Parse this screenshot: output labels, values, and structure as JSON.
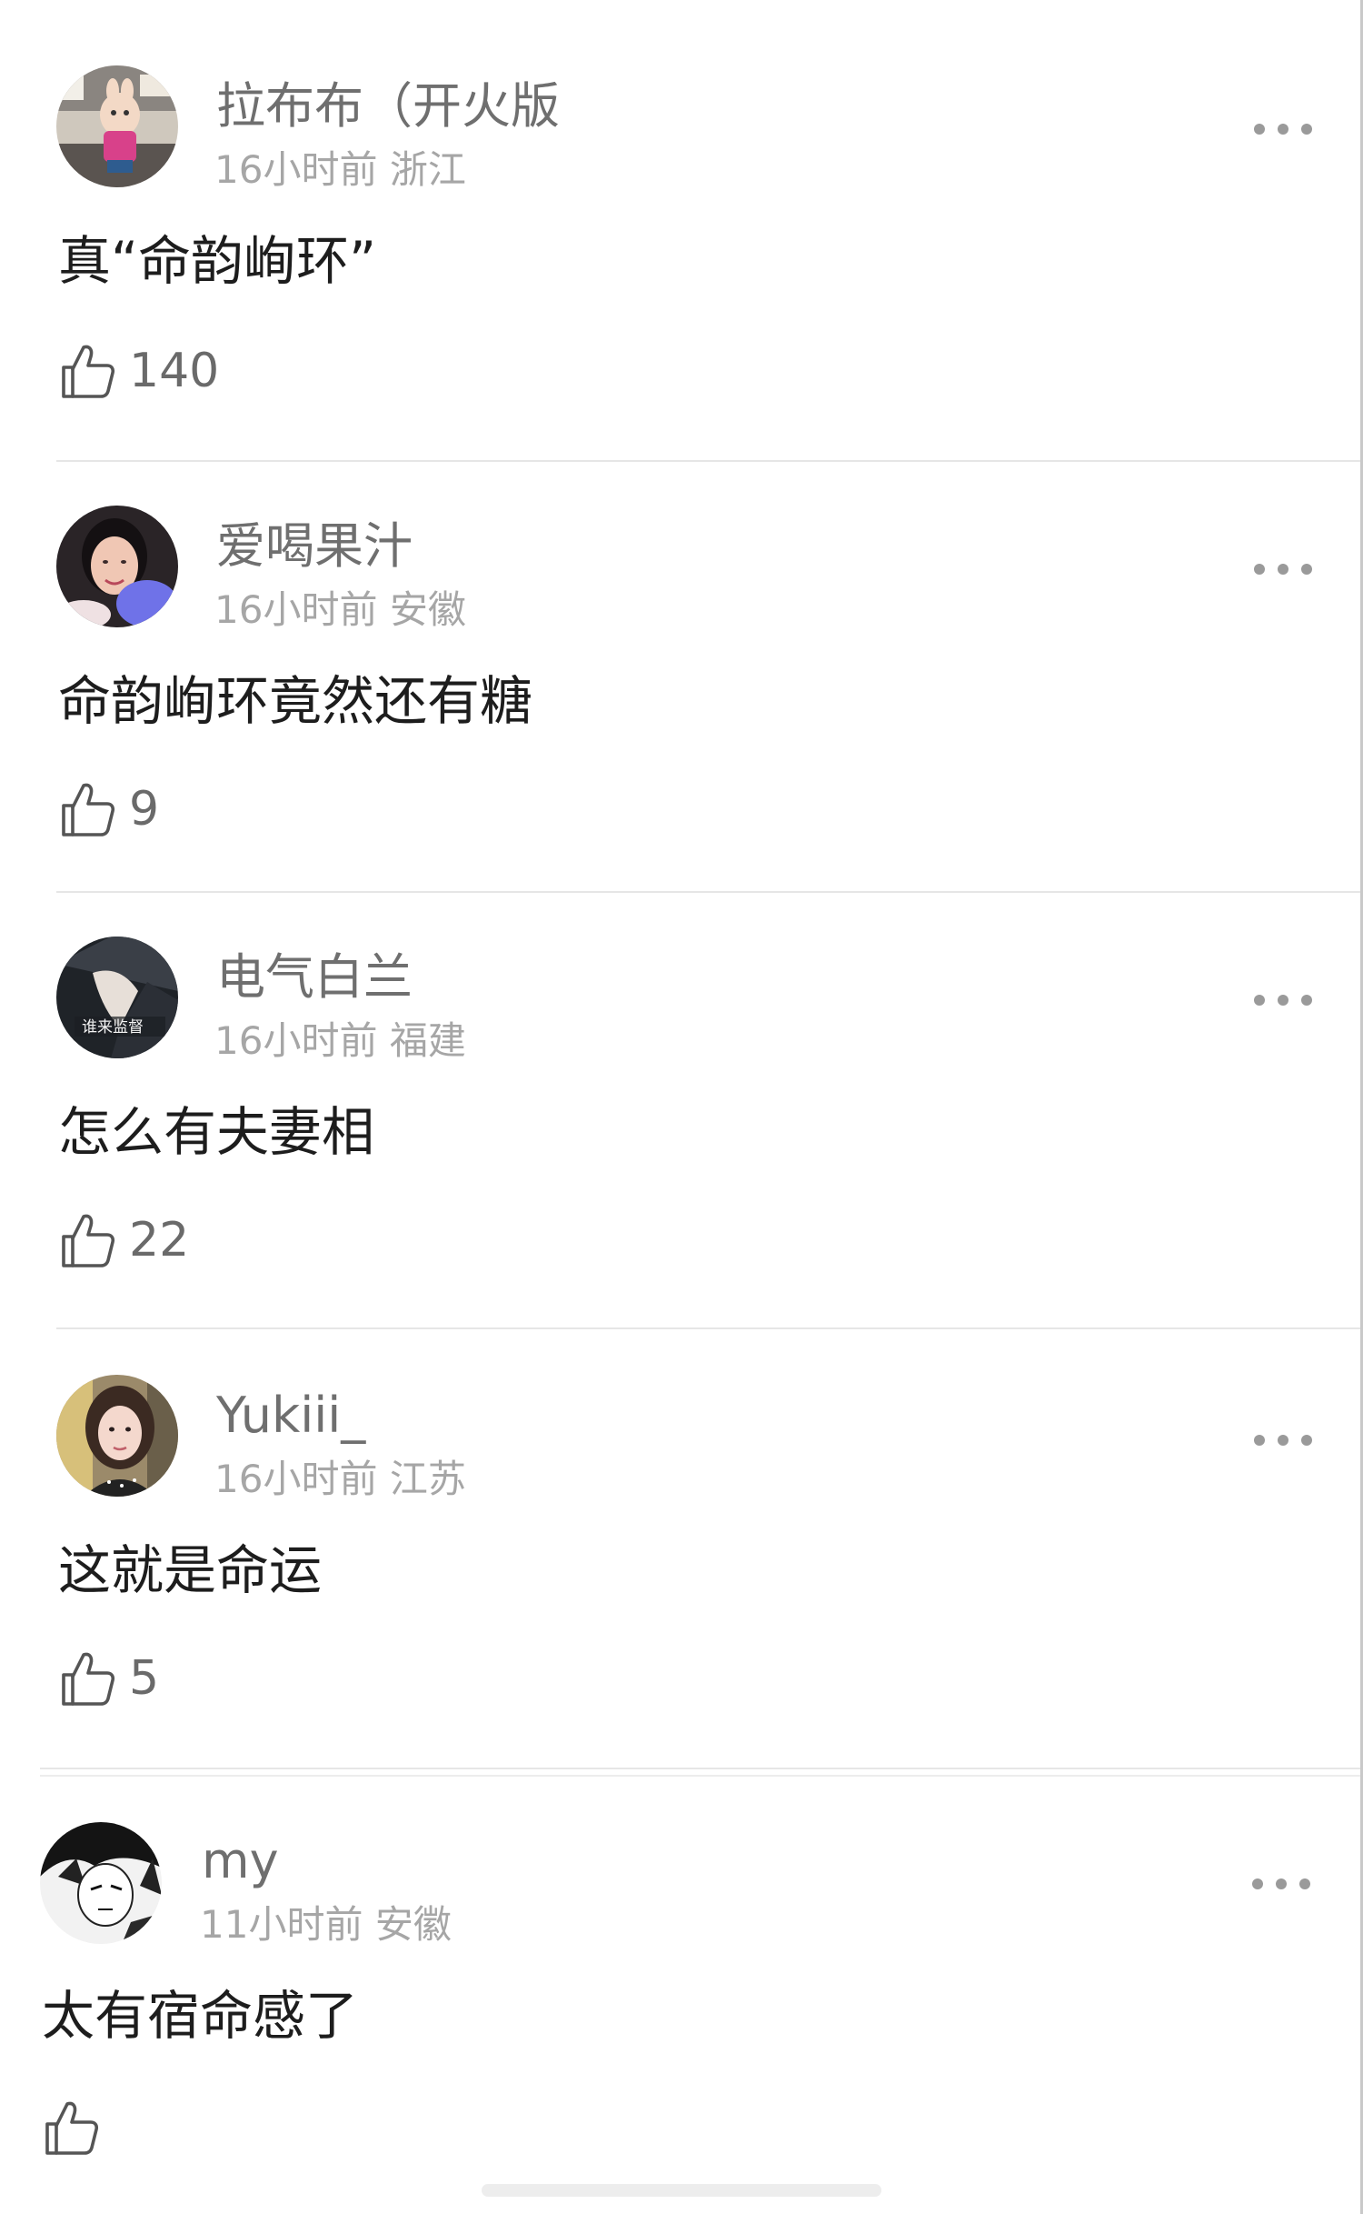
{
  "comments": [
    {
      "username": "拉布布（开火版",
      "time": "16小时前",
      "location": "浙江",
      "text": "真“命韵峋环”",
      "likes": "140"
    },
    {
      "username": "爱喝果汁",
      "time": "16小时前",
      "location": "安徽",
      "text": "命韵峋环竟然还有糖",
      "likes": "9"
    },
    {
      "username": "电气白兰",
      "time": "16小时前",
      "location": "福建",
      "text": "怎么有夫妻相",
      "likes": "22",
      "avatar_text": "谁来监督"
    },
    {
      "username": "Yukiii_",
      "time": "16小时前",
      "location": "江苏",
      "text": "这就是命运",
      "likes": "5"
    },
    {
      "username": "my",
      "time": "11小时前",
      "location": "安徽",
      "text": "太有宿命感了",
      "likes": ""
    }
  ],
  "icons": {
    "like": "thumbs-up-outline-icon",
    "more": "more-horizontal-icon"
  },
  "colors": {
    "username": "#6f6f6f",
    "meta": "#a6a6a6",
    "content": "#1d1d1d",
    "divider": "#e6e6e6",
    "more_dots": "#9a9a9a"
  }
}
